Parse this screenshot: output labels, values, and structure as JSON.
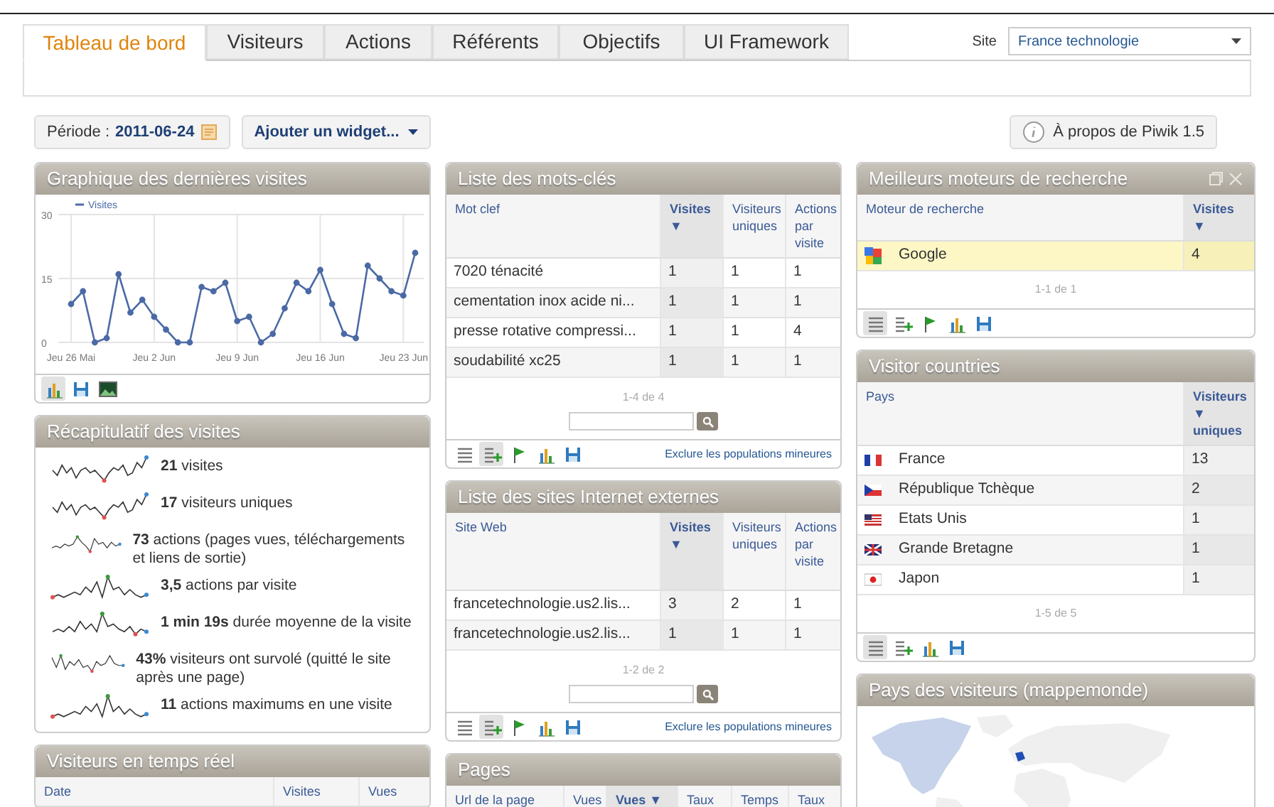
{
  "tabs": [
    {
      "label": "Tableau de bord",
      "selected": true
    },
    {
      "label": "Visiteurs",
      "selected": false
    },
    {
      "label": "Actions",
      "selected": false
    },
    {
      "label": "Référents",
      "selected": false
    },
    {
      "label": "Objectifs",
      "selected": false
    },
    {
      "label": "UI Framework",
      "selected": false
    }
  ],
  "site_selector": {
    "label": "Site",
    "value": "France technologie"
  },
  "period": {
    "label": "Période :",
    "value": "2011-06-24"
  },
  "add_widget_button": {
    "label": "Ajouter un widget..."
  },
  "about_button": {
    "label": "À propos de Piwik 1.5"
  },
  "columns": [
    [
      {
        "kind": "chart",
        "title": "Graphique des dernières visites",
        "chart_data": {
          "type": "line",
          "categories": [
            "Jeu 26 Mai",
            null,
            null,
            null,
            null,
            null,
            null,
            "Jeu 2 Jun",
            null,
            null,
            null,
            null,
            null,
            null,
            "Jeu 9 Jun",
            null,
            null,
            null,
            null,
            null,
            null,
            "Jeu 16 Jun",
            null,
            null,
            null,
            null,
            null,
            null,
            "Jeu 23 Jun",
            null
          ],
          "ylim": [
            0,
            30
          ],
          "yticks": [
            0,
            15,
            30
          ],
          "grid": true,
          "series": [
            {
              "name": "Visites",
              "color": "#4b6aa5",
              "marker": true,
              "values": [
                9,
                12,
                0,
                1,
                16,
                7,
                10,
                6,
                3,
                0,
                0,
                13,
                12,
                14,
                5,
                6,
                0,
                2,
                8,
                14,
                12,
                17,
                9,
                2,
                1,
                18,
                15,
                12,
                11,
                21
              ]
            }
          ]
        },
        "footer_icons": [
          {
            "kind": "bars",
            "selected": true
          },
          {
            "kind": "save",
            "selected": false
          },
          {
            "kind": "image",
            "selected": false
          }
        ]
      },
      {
        "kind": "summary",
        "title": "Récapitulatif des visites",
        "items": [
          "**21** visites",
          "**17** visiteurs uniques",
          "**73** actions (pages vues, téléchargements et liens de sortie)",
          "**3,5** actions par visite",
          "**1 min 19s** durée moyenne de la visite",
          "**43%** visiteurs ont survolé (quitté le site après une page)",
          "**11** actions maximums en une visite"
        ]
      },
      {
        "kind": "table",
        "title": "Visiteurs en temps réel",
        "columns": [
          {
            "label": "Date",
            "sorted": false
          },
          {
            "label": "Visites",
            "sorted": false
          },
          {
            "label": "Vues",
            "sorted": false
          }
        ]
      }
    ],
    [
      {
        "kind": "table",
        "title": "Liste des mots-clés",
        "columns": [
          {
            "label": "Mot clef",
            "sorted": false
          },
          {
            "label": "Visites ▼",
            "sorted": true
          },
          {
            "label": "Visiteurs uniques",
            "sorted": false
          },
          {
            "label": "Actions par visite",
            "sorted": false
          }
        ],
        "rows": [
          {
            "cells": [
              "7020 ténacité",
              "1",
              "1",
              "1"
            ],
            "highlighted": false
          },
          {
            "cells": [
              "cementation inox acide ni...",
              "1",
              "1",
              "1"
            ],
            "highlighted": false
          },
          {
            "cells": [
              "presse rotative compressi...",
              "1",
              "1",
              "4"
            ],
            "highlighted": false
          },
          {
            "cells": [
              "soudabilité xc25",
              "1",
              "1",
              "1"
            ],
            "highlighted": false
          }
        ],
        "pagination": "1-4 de 4",
        "search": true,
        "footer_icons": [
          {
            "kind": "table",
            "selected": false
          },
          {
            "kind": "table-more",
            "selected": true
          },
          {
            "kind": "flag",
            "selected": false
          },
          {
            "kind": "bars",
            "selected": false
          },
          {
            "kind": "save",
            "selected": false
          }
        ],
        "footer_link": "Exclure les populations mineures"
      },
      {
        "kind": "table",
        "title": "Liste des sites Internet externes",
        "columns": [
          {
            "label": "Site Web",
            "sorted": false
          },
          {
            "label": "Visites ▼",
            "sorted": true
          },
          {
            "label": "Visiteurs uniques",
            "sorted": false
          },
          {
            "label": "Actions par visite",
            "sorted": false
          }
        ],
        "rows": [
          {
            "cells": [
              "francetechnologie.us2.lis...",
              "3",
              "2",
              "1"
            ],
            "highlighted": false
          },
          {
            "cells": [
              "francetechnologie.us2.lis...",
              "1",
              "1",
              "1"
            ],
            "highlighted": false
          }
        ],
        "pagination": "1-2 de 2",
        "search": true,
        "footer_icons": [
          {
            "kind": "table",
            "selected": false
          },
          {
            "kind": "table-more",
            "selected": true
          },
          {
            "kind": "flag",
            "selected": false
          },
          {
            "kind": "bars",
            "selected": false
          },
          {
            "kind": "save",
            "selected": false
          }
        ],
        "footer_link": "Exclure les populations mineures"
      },
      {
        "kind": "table",
        "title": "Pages",
        "columns": [
          {
            "label": "Url de la page",
            "sorted": false
          },
          {
            "label": "Vues",
            "sorted": false
          },
          {
            "label": "Vues ▼",
            "sorted": true
          },
          {
            "label": "Taux",
            "sorted": false
          },
          {
            "label": "Temps",
            "sorted": false
          },
          {
            "label": "Taux",
            "sorted": false
          }
        ]
      }
    ],
    [
      {
        "kind": "table",
        "title": "Meilleurs moteurs de recherche",
        "window_controls": true,
        "columns": [
          {
            "label": "Moteur de recherche",
            "sorted": false
          },
          {
            "label": "Visites ▼",
            "sorted": true
          }
        ],
        "rows": [
          {
            "kind": "engine",
            "cells": [
              "Google",
              "4"
            ],
            "highlighted": true
          }
        ],
        "pagination": "1-1 de 1",
        "footer_icons": [
          {
            "kind": "table",
            "selected": true
          },
          {
            "kind": "table-more",
            "selected": false
          },
          {
            "kind": "flag",
            "selected": false
          },
          {
            "kind": "bars",
            "selected": false
          },
          {
            "kind": "save",
            "selected": false
          }
        ]
      },
      {
        "kind": "table",
        "title": "Visitor countries",
        "columns": [
          {
            "label": "Pays",
            "sorted": false
          },
          {
            "label": "Visiteurs ▼ uniques",
            "sorted": true
          }
        ],
        "rows": [
          {
            "kind": "fr",
            "cells": [
              "France",
              "13"
            ],
            "highlighted": false
          },
          {
            "kind": "cz",
            "cells": [
              "République Tchèque",
              "2"
            ],
            "highlighted": false
          },
          {
            "kind": "us",
            "cells": [
              "Etats Unis",
              "1"
            ],
            "highlighted": false
          },
          {
            "kind": "gb",
            "cells": [
              "Grande Bretagne",
              "1"
            ],
            "highlighted": false
          },
          {
            "kind": "jp",
            "cells": [
              "Japon",
              "1"
            ],
            "highlighted": false
          }
        ],
        "pagination": "1-5 de 5",
        "footer_icons": [
          {
            "kind": "table",
            "selected": true
          },
          {
            "kind": "table-more",
            "selected": false
          },
          {
            "kind": "bars",
            "selected": false
          },
          {
            "kind": "save",
            "selected": false
          }
        ]
      },
      {
        "kind": "map",
        "title": "Pays des visiteurs (mappemonde)"
      }
    ]
  ]
}
